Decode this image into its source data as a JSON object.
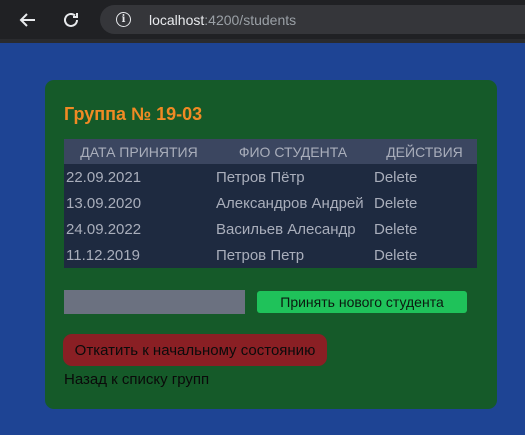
{
  "browser": {
    "url_host": "localhost",
    "url_path": ":4200/students"
  },
  "page": {
    "title": "Группа № 19-03",
    "table": {
      "headers": [
        "ДАТА ПРИНЯТИЯ",
        "ФИО СТУДЕНТА",
        "ДЕЙСТВИЯ"
      ],
      "rows": [
        {
          "date": "22.09.2021",
          "name": "Петров Пётр",
          "action": "Delete"
        },
        {
          "date": "13.09.2020",
          "name": "Александров Андрей",
          "action": "Delete"
        },
        {
          "date": "24.09.2022",
          "name": "Васильев Алесандр",
          "action": "Delete"
        },
        {
          "date": "11.12.2019",
          "name": "Петров Петр",
          "action": "Delete"
        }
      ]
    },
    "new_student_input_value": "",
    "accept_button_label": "Принять нового студента",
    "reset_button_label": "Откатить к начальному состоянию",
    "back_link_label": "Назад к списку групп"
  },
  "colors": {
    "page_background": "#1e4494",
    "card_background": "#155a29",
    "title": "#f08a24",
    "accept_button": "#1fc25a",
    "reset_button": "#8a1f24"
  }
}
